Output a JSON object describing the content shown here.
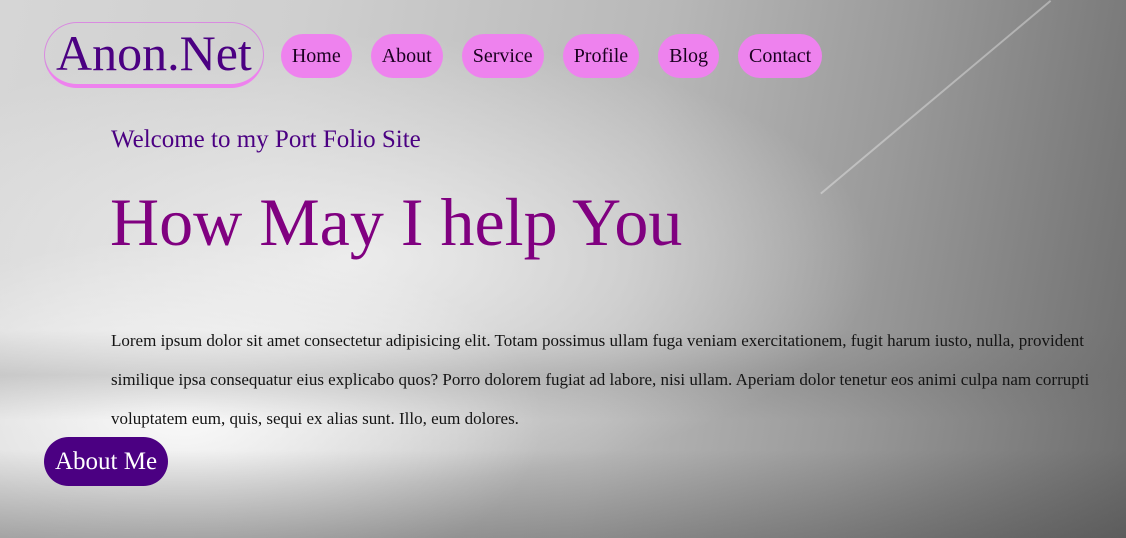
{
  "brand": {
    "logo_text": "Anon.Net"
  },
  "nav": {
    "items": [
      {
        "label": "Home"
      },
      {
        "label": "About"
      },
      {
        "label": "Service"
      },
      {
        "label": "Profile"
      },
      {
        "label": "Blog"
      },
      {
        "label": "Contact"
      }
    ]
  },
  "hero": {
    "welcome": "Welcome to my Port Folio Site",
    "headline": "How May I help You",
    "paragraph": "Lorem ipsum dolor sit amet consectetur adipisicing elit. Totam possimus ullam fuga veniam exercitationem, fugit harum iusto, nulla, provident similique ipsa consequatur eius explicabo quos? Porro dolorem fugiat ad labore, nisi ullam. Aperiam dolor tenetur eos animi culpa nam corrupti voluptatem eum, quis, sequi ex alias sunt. Illo, eum dolores.",
    "cta_label": "About Me"
  },
  "colors": {
    "logo_text": "#4b0082",
    "nav_background": "#ee82ee",
    "welcome_text": "#4b0082",
    "headline_text": "#800080",
    "cta_background": "#4b0082",
    "cta_text": "#ffffff"
  }
}
